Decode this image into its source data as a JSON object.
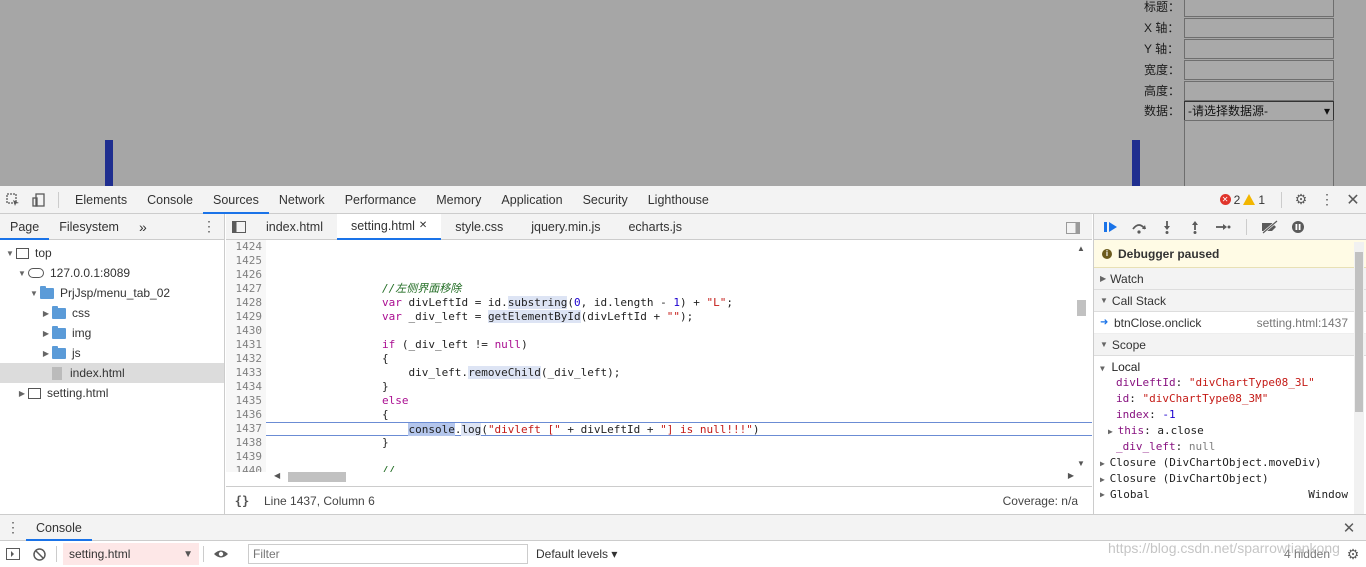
{
  "viewport": {
    "form": {
      "labels": [
        "标题：",
        "X 轴：",
        "Y 轴：",
        "宽度：",
        "高度：",
        "数据："
      ],
      "select_value": "-请选择数据源-"
    }
  },
  "toolbar": {
    "tabs": [
      "Elements",
      "Console",
      "Sources",
      "Network",
      "Performance",
      "Memory",
      "Application",
      "Security",
      "Lighthouse"
    ],
    "active_tab": "Sources",
    "error_count": "2",
    "warning_count": "1"
  },
  "navigator": {
    "tabs": [
      "Page",
      "Filesystem"
    ],
    "more": "»",
    "tree": [
      {
        "label": "top",
        "depth": 0,
        "icon": "frame",
        "expanded": true
      },
      {
        "label": "127.0.0.1:8089",
        "depth": 1,
        "icon": "cloud",
        "expanded": true
      },
      {
        "label": "PrjJsp/menu_tab_02",
        "depth": 2,
        "icon": "folder",
        "expanded": true
      },
      {
        "label": "css",
        "depth": 3,
        "icon": "folder",
        "expanded": false
      },
      {
        "label": "img",
        "depth": 3,
        "icon": "folder",
        "expanded": false
      },
      {
        "label": "js",
        "depth": 3,
        "icon": "folder",
        "expanded": false
      },
      {
        "label": "index.html",
        "depth": 3,
        "icon": "file",
        "selected": true
      },
      {
        "label": "setting.html",
        "depth": 1,
        "icon": "frame",
        "expanded": false
      }
    ]
  },
  "editor": {
    "tabs": [
      "index.html",
      "setting.html",
      "style.css",
      "jquery.min.js",
      "echarts.js"
    ],
    "active_tab": "setting.html",
    "status": "Line 1437, Column 6",
    "coverage": "Coverage: n/a",
    "format_label": "{}",
    "lines": [
      {
        "n": "1424",
        "html": ""
      },
      {
        "n": "1425",
        "html": ""
      },
      {
        "n": "1426",
        "html": ""
      },
      {
        "n": "1427",
        "html": "                <span class=\"cm\">//左侧界面移除</span>"
      },
      {
        "n": "1428",
        "html": "                <span class=\"kw\">var</span> divLeftId = id.<span class=\"hl\">substring</span>(<span class=\"num\">0</span>, id.length - <span class=\"num\">1</span>) + <span class=\"str\">\"L\"</span>;"
      },
      {
        "n": "1429",
        "html": "                <span class=\"kw\">var</span> _div_left = <span class=\"hl\">getElementById</span>(divLeftId + <span class=\"str\">\"\"</span>);"
      },
      {
        "n": "1430",
        "html": ""
      },
      {
        "n": "1431",
        "html": "                <span class=\"kw\">if</span> (_div_left != <span class=\"kw\">null</span>)"
      },
      {
        "n": "1432",
        "html": "                {"
      },
      {
        "n": "1433",
        "html": "                    div_left.<span class=\"hl\">removeChild</span>(_div_left);"
      },
      {
        "n": "1434",
        "html": "                }"
      },
      {
        "n": "1435",
        "html": "                <span class=\"kw\">else</span>"
      },
      {
        "n": "1436",
        "html": "                {"
      },
      {
        "n": "1437",
        "html": "                    <span class=\"hl-sel\">console</span>.<span class=\"hl\">log</span>(<span class=\"str\">\"divleft [\"</span> + divLeftId + <span class=\"str\">\"] is null!!!\"</span>)",
        "current": true
      },
      {
        "n": "1438",
        "html": "                }"
      },
      {
        "n": "1439",
        "html": ""
      },
      {
        "n": "1440",
        "html": "                <span class=\"cm\">//</span>"
      }
    ]
  },
  "debugger": {
    "paused_text": "Debugger paused",
    "sections": {
      "watch": "Watch",
      "call_stack": "Call Stack",
      "scope": "Scope"
    },
    "call_stack": [
      {
        "fn": "btnClose.onclick",
        "loc": "setting.html:1437"
      }
    ],
    "local_label": "Local",
    "scope_vars": [
      {
        "name": "divLeftId",
        "value": "\"divChartType08_3L\"",
        "kind": "str"
      },
      {
        "name": "id",
        "value": "\"divChartType08_3M\"",
        "kind": "str"
      },
      {
        "name": "index",
        "value": "-1",
        "kind": "num"
      },
      {
        "name": "this",
        "value": "a.close",
        "kind": "obj",
        "expandable": true
      },
      {
        "name": "_div_left",
        "value": "null",
        "kind": "null"
      }
    ],
    "closures": [
      "Closure (DivChartObject.moveDiv)",
      "Closure (DivChartObject)"
    ],
    "global_label": "Global",
    "global_value": "Window"
  },
  "drawer": {
    "tab": "Console",
    "context": "setting.html",
    "filter_placeholder": "Filter",
    "levels": "Default levels ▾",
    "hidden": "4 hidden"
  },
  "watermark": "https://blog.csdn.net/sparrowtiankong"
}
